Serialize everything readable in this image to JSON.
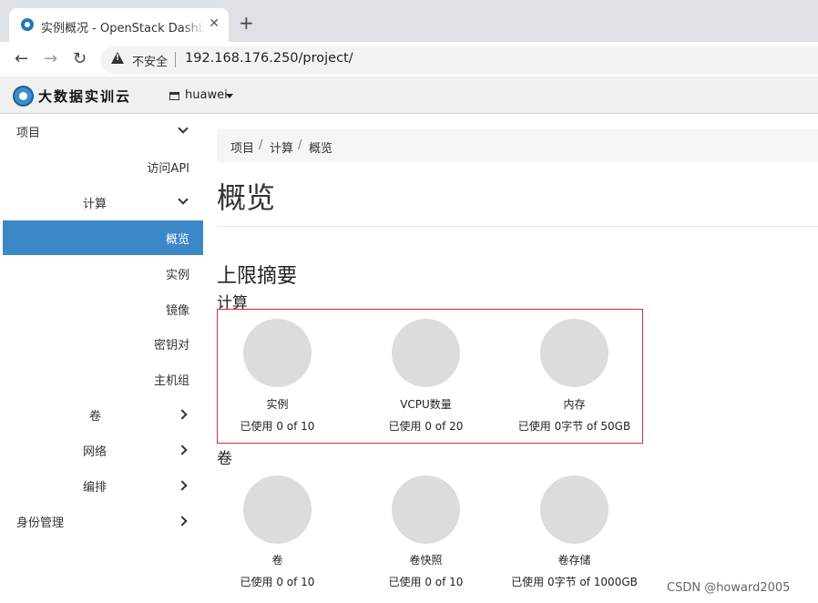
{
  "browser": {
    "tab_title": "实例概况 - OpenStack Dashboard",
    "close_glyph": "✕",
    "newtab_glyph": "+",
    "back_glyph": "←",
    "forward_glyph": "→",
    "reload_glyph": "↻",
    "security_label": "不安全",
    "url": "192.168.176.250/project/"
  },
  "header": {
    "logo_text": "大数据实训云",
    "project_name": "huawei"
  },
  "sidebar": {
    "items": [
      {
        "label": "项目",
        "chevron": "down"
      },
      {
        "label": "访问API"
      },
      {
        "label": "计算",
        "chevron": "down"
      },
      {
        "label": "概览",
        "active": true
      },
      {
        "label": "实例"
      },
      {
        "label": "镜像"
      },
      {
        "label": "密钥对"
      },
      {
        "label": "主机组"
      },
      {
        "label": "卷",
        "chevron": "right"
      },
      {
        "label": "网络",
        "chevron": "right"
      },
      {
        "label": "编排",
        "chevron": "right"
      },
      {
        "label": "身份管理",
        "chevron": "right"
      }
    ]
  },
  "breadcrumb": {
    "items": [
      "项目",
      "计算",
      "概览"
    ],
    "separator": "/"
  },
  "main": {
    "title": "概览",
    "limits_heading": "上限摘要",
    "compute_heading": "计算",
    "volume_heading": "卷",
    "compute_charts": [
      {
        "label": "实例",
        "usage": "已使用 0 of 10",
        "used": 0,
        "total": 10
      },
      {
        "label": "VCPU数量",
        "usage": "已使用 0 of 20",
        "used": 0,
        "total": 20
      },
      {
        "label": "内存",
        "usage": "已使用 0字节 of 50GB",
        "used": 0,
        "total": 50
      }
    ],
    "volume_charts": [
      {
        "label": "卷",
        "usage": "已使用 0 of 10",
        "used": 0,
        "total": 10
      },
      {
        "label": "卷快照",
        "usage": "已使用 0 of 10",
        "used": 0,
        "total": 10
      },
      {
        "label": "卷存储",
        "usage": "已使用 0字节 of 1000GB",
        "used": 0,
        "total": 1000
      }
    ]
  },
  "colors": {
    "active_nav": "#3b87c8",
    "highlight_border": "#d32f2f",
    "pie_empty": "#dcdcdc"
  },
  "watermark": "CSDN @howard2005"
}
